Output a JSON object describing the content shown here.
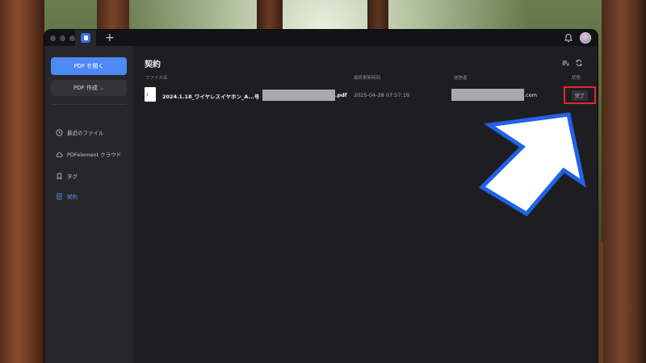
{
  "window": {
    "app_name": "PDFelement"
  },
  "sidebar": {
    "open_pdf_label": "PDF を開く",
    "create_pdf_label": "PDF 作成",
    "items": [
      {
        "label": "最近のファイル",
        "icon": "clock-icon"
      },
      {
        "label": "PDFelement クラウド",
        "icon": "cloud-icon"
      },
      {
        "label": "タグ",
        "icon": "bookmark-icon"
      },
      {
        "label": "契約",
        "icon": "document-icon",
        "active": true
      }
    ]
  },
  "main": {
    "title": "契約",
    "columns": {
      "file_name": "ファイル名",
      "last_modified": "最終更新時刻",
      "sender": "送信者",
      "status": "状態"
    },
    "rows": [
      {
        "file_name_prefix": "2024.1.18_ワイヤレスイヤホン_A...号",
        "file_ext": ".pdf",
        "last_modified": "2025-04-28 07:57:19",
        "sender_suffix": ".com",
        "status": "完了"
      }
    ]
  },
  "colors": {
    "accent": "#4d8af5",
    "highlight_box": "#e0292b",
    "arrow_fill": "#ffffff",
    "arrow_outline": "#1f63e8"
  }
}
